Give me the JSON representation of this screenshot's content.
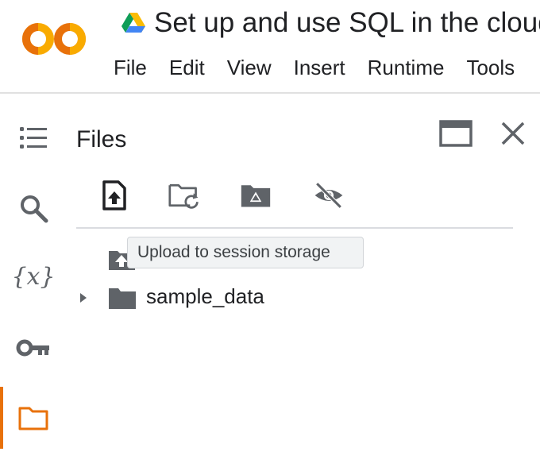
{
  "app": {
    "notebook_title": "Set up and use SQL in the cloud",
    "logo_icon": "colab-logo",
    "drive_icon": "google-drive-icon"
  },
  "menu": [
    "File",
    "Edit",
    "View",
    "Insert",
    "Runtime",
    "Tools"
  ],
  "rail": [
    {
      "icon": "table-of-contents-icon"
    },
    {
      "icon": "search-icon"
    },
    {
      "icon": "variables-icon",
      "text": "{x}"
    },
    {
      "icon": "secrets-key-icon"
    },
    {
      "icon": "folder-icon",
      "active": true
    }
  ],
  "panel": {
    "title": "Files",
    "toolbar": [
      {
        "icon": "upload-file-icon"
      },
      {
        "icon": "refresh-folder-icon"
      },
      {
        "icon": "mount-drive-icon"
      },
      {
        "icon": "hide-hidden-files-icon"
      }
    ],
    "tooltip": "Upload to session storage",
    "tree": [
      {
        "name": "sample_data",
        "type": "folder",
        "expanded": false
      }
    ]
  },
  "colors": {
    "accent": "#e8710a",
    "logo_orange": "#f9ab00",
    "logo_dark_orange": "#e8710a",
    "icon_gray": "#5f6368"
  }
}
